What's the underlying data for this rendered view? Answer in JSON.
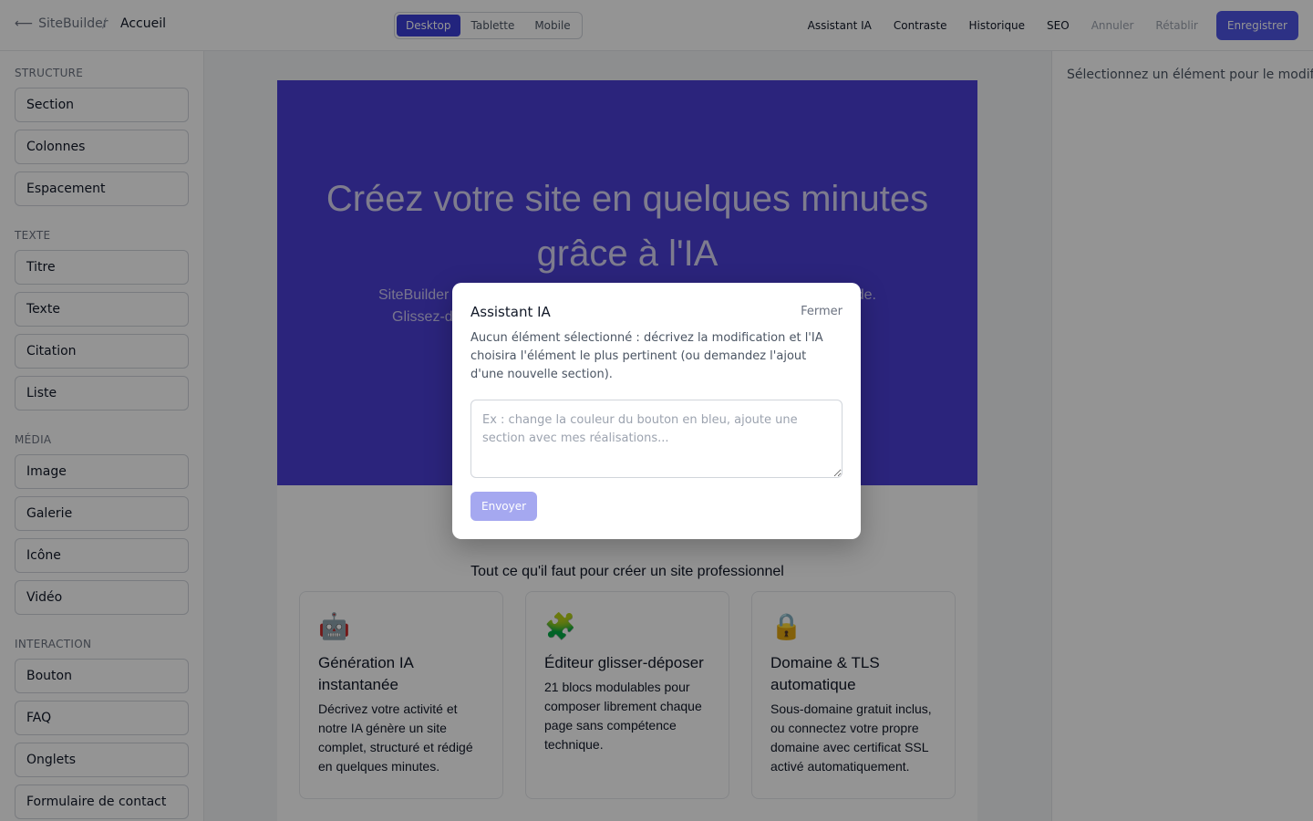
{
  "header": {
    "app_name": "SiteBuilder",
    "back_icon": "arrow-left-icon",
    "separator": "/",
    "page_name": "Accueil",
    "devices": [
      "Desktop",
      "Tablette",
      "Mobile"
    ],
    "active_device": "Desktop",
    "actions": {
      "ai_assistant": "Assistant IA",
      "contrast": "Contraste",
      "history": "Historique",
      "seo": "SEO",
      "undo": "Annuler",
      "redo": "Rétablir",
      "save": "Enregistrer"
    }
  },
  "sidebar": {
    "groups": [
      {
        "title": "STRUCTURE",
        "items": [
          "Section",
          "Colonnes",
          "Espacement"
        ]
      },
      {
        "title": "TEXTE",
        "items": [
          "Titre",
          "Texte",
          "Citation",
          "Liste"
        ]
      },
      {
        "title": "MÉDIA",
        "items": [
          "Image",
          "Galerie",
          "Icône",
          "Vidéo"
        ]
      },
      {
        "title": "INTERACTION",
        "items": [
          "Bouton",
          "FAQ",
          "Onglets",
          "Formulaire de contact"
        ]
      }
    ]
  },
  "canvas": {
    "hero": {
      "title": "Créez votre site en quelques minutes grâce à l'IA",
      "subtitle_start": "SiteBuilder",
      "subtitle_line2_start": "Glissez-d",
      "subtitle_end": "de."
    },
    "features": {
      "title": "Tout ce qu'il faut pour créer un site professionnel",
      "cards": [
        {
          "icon": "robot-icon",
          "emoji": "🤖",
          "title": "Génération IA instantanée",
          "text": "Décrivez votre activité et notre IA génère un site complet, structuré et rédigé en quelques minutes."
        },
        {
          "icon": "puzzle-icon",
          "emoji": "🧩",
          "title": "Éditeur glisser-déposer",
          "text": "21 blocs modulables pour composer librement chaque page sans compétence technique."
        },
        {
          "icon": "lock-icon",
          "emoji": "🔒",
          "title": "Domaine & TLS automatique",
          "text": "Sous-domaine gratuit inclus, ou connectez votre propre domaine avec certificat SSL activé automatiquement."
        }
      ]
    }
  },
  "right_panel": {
    "hint": "Sélectionnez un élément pour le modifier."
  },
  "modal": {
    "title": "Assistant IA",
    "close_label": "Fermer",
    "description": "Aucun élément sélectionné : décrivez la modification et l'IA choisira l'élément le plus pertinent (ou demandez l'ajout d'une nouvelle section).",
    "input_value": "",
    "input_placeholder": "Ex : change la couleur du bouton en bleu, ajoute une section avec mes réalisations...",
    "send_label": "Envoyer"
  },
  "colors": {
    "accent": "#4f55e6",
    "hero_bg": "#4a3fd6",
    "send_disabled": "#a5a8f0"
  }
}
